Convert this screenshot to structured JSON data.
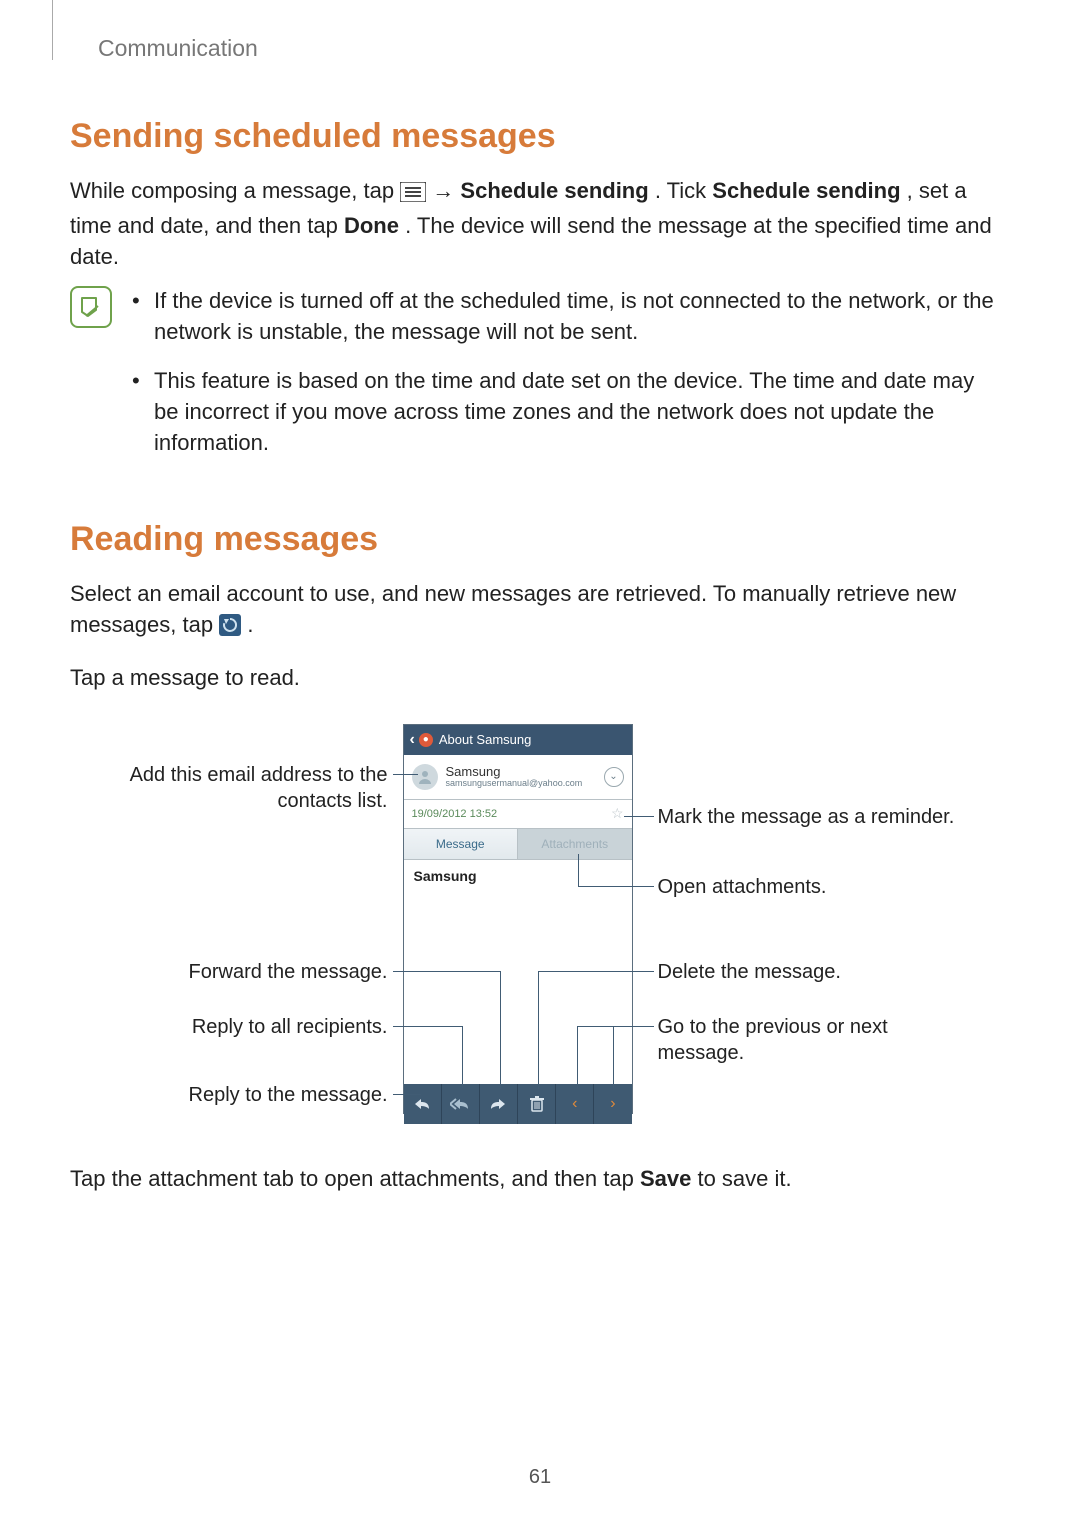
{
  "header": {
    "section_label": "Communication"
  },
  "section1": {
    "heading": "Sending scheduled messages",
    "para_pre": "While composing a message, tap ",
    "arrow": " → ",
    "bold_action1": "Schedule sending",
    "mid1": ". Tick ",
    "bold_action2": "Schedule sending",
    "mid2": ", set a time and date, and then tap ",
    "bold_done": "Done",
    "para_post": ". The device will send the message at the specified time and date.",
    "note1": "If the device is turned off at the scheduled time, is not connected to the network, or the network is unstable, the message will not be sent.",
    "note2": "This feature is based on the time and date set on the device. The time and date may be incorrect if you move across time zones and the network does not update the information."
  },
  "section2": {
    "heading": "Reading messages",
    "para1_pre": "Select an email account to use, and new messages are retrieved. To manually retrieve new messages, tap ",
    "para1_post": ".",
    "para2": "Tap a message to read."
  },
  "figure": {
    "app_title": "About Samsung",
    "sender_name": "Samsung",
    "sender_email": "samsungusermanual@yahoo.com",
    "date": "19/09/2012 13:52",
    "tab_message": "Message",
    "tab_attachments": "Attachments",
    "body_subject": "Samsung",
    "callouts": {
      "add_contact": "Add this email address to the contacts list.",
      "mark_reminder": "Mark the message as a reminder.",
      "open_attachments": "Open attachments.",
      "forward": "Forward the message.",
      "reply_all": "Reply to all recipients.",
      "reply": "Reply to the message.",
      "delete": "Delete the message.",
      "prev_next": "Go to the previous or next message."
    }
  },
  "section3": {
    "para_pre": "Tap the attachment tab to open attachments, and then tap ",
    "bold_save": "Save",
    "para_post": " to save it."
  },
  "page_number": "61"
}
